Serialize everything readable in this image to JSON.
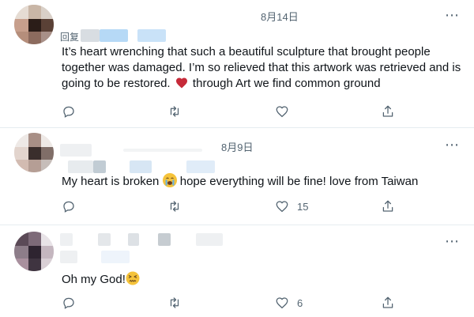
{
  "tweets": [
    {
      "date": "8月14日",
      "reply_prefix": "回复",
      "text_before": "It’s heart wrenching that such a beautiful sculpture that brought people together was damaged. I’m so relieved that this artwork was retrieved and is going to be restored. ",
      "text_after": " through Art we find common ground",
      "inline_icon": "red-heart-icon",
      "like_count": ""
    },
    {
      "date": "8月9日",
      "text_before": "My heart is broken ",
      "text_after": " hope everything will be fine! love from Taiwan",
      "inline_icon": "crying-face-icon",
      "like_count": "15"
    },
    {
      "date": "",
      "text_before": "Oh my God!",
      "text_after": "",
      "inline_icon": "confounded-face-icon",
      "like_count": "6"
    }
  ],
  "action_icons": [
    "reply-icon",
    "retweet-icon",
    "like-icon",
    "share-icon"
  ],
  "colors": {
    "text": "#0f1419",
    "muted": "#536471",
    "divider": "#e6ecf0",
    "heart": "#e0245e",
    "blur_blue": "#b6d9f6"
  }
}
